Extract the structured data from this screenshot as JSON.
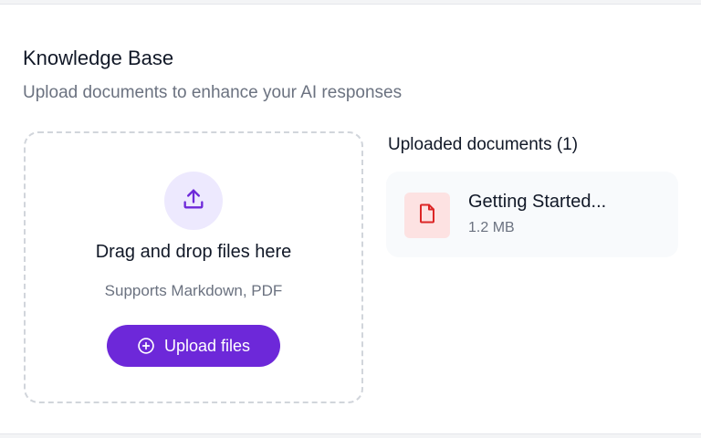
{
  "knowledge_base": {
    "title": "Knowledge Base",
    "subtitle": "Upload documents to enhance your AI responses"
  },
  "dropzone": {
    "icon": "upload-icon",
    "title": "Drag and drop files here",
    "hint": "Supports Markdown, PDF",
    "button_label": "Upload files",
    "button_icon": "plus-circle-icon"
  },
  "uploaded": {
    "heading": "Uploaded documents (1)",
    "documents": [
      {
        "name": "Getting Started...",
        "size": "1.2 MB",
        "icon": "file-icon"
      }
    ]
  },
  "colors": {
    "accent": "#6d28d9",
    "accent_light": "#ede9fe",
    "file_icon": "#dc2626",
    "file_icon_bg": "#fde2e2"
  }
}
